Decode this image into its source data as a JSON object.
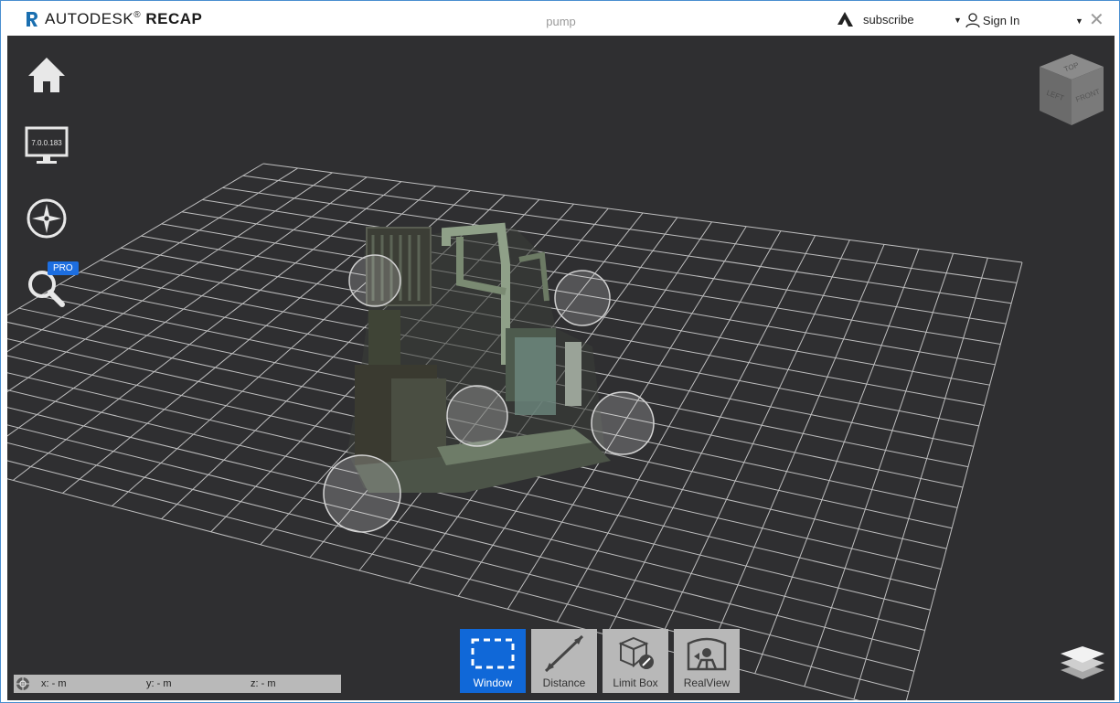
{
  "app": {
    "brand_light": "AUTODESK",
    "brand_reg": "®",
    "brand_bold": "RECAP",
    "document_title": "pump"
  },
  "header": {
    "subscribe_label": "subscribe",
    "signin_label": "Sign In",
    "close_glyph": "✕",
    "caret_glyph": "▼"
  },
  "left_tools": {
    "home_icon": "home-icon",
    "version_label": "7.0.0.183",
    "navigate_icon": "compass-icon",
    "search_icon": "search-icon",
    "pro_badge": "PRO"
  },
  "viewcube": {
    "faces": [
      "TOP",
      "LEFT",
      "FRONT"
    ]
  },
  "toolbar": {
    "buttons": [
      {
        "label": "Window",
        "icon": "window-select-icon",
        "active": true
      },
      {
        "label": "Distance",
        "icon": "distance-icon",
        "active": false
      },
      {
        "label": "Limit Box",
        "icon": "limit-box-icon",
        "active": false
      },
      {
        "label": "RealView",
        "icon": "realview-icon",
        "active": false
      }
    ]
  },
  "coordinates": {
    "x": "x:  -  m",
    "y": "y:  -  m",
    "z": "z:  -  m"
  },
  "colors": {
    "viewport_bg": "#2f2f31",
    "active_blue": "#1068d8",
    "pro_blue": "#1d6ee0"
  }
}
